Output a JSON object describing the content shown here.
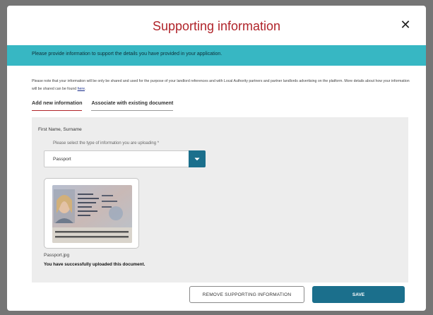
{
  "modal": {
    "title": "Supporting information",
    "close_label": "✕",
    "banner": "Please provide information to support the details you have provided in your application.",
    "notice_text": "Please note that your information will be only be shared and used for the purpose of your landlord references and with Local Authority partners and partner landlords advertising on the platform. More details about how your information will be shared can be found",
    "notice_link": "here",
    "notice_end": "."
  },
  "tabs": [
    {
      "label": "Add new information",
      "active": true
    },
    {
      "label": "Associate with existing document",
      "active": false
    }
  ],
  "form": {
    "person_name": "First Name, Surname",
    "select_label": "Please select the type of information you are uploading *",
    "select_value": "Passport",
    "file_name": "Passport.jpg",
    "success_message": "You have successfully uploaded this document."
  },
  "buttons": {
    "remove": "REMOVE SUPPORTING INFORMATION",
    "save": "SAVE"
  },
  "colors": {
    "title": "#b0242a",
    "banner": "#37b7c3",
    "primary": "#1b6f8c",
    "panel": "#ededed"
  },
  "icons": {
    "close": "close-icon",
    "dropdown": "chevron-down-icon",
    "passport": "passport-image"
  }
}
